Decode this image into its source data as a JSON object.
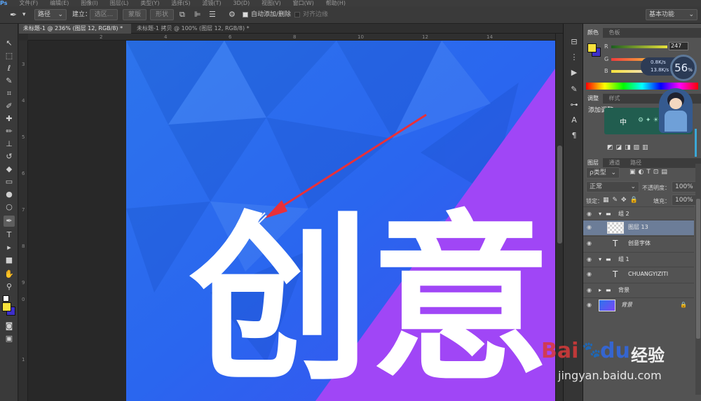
{
  "menubar": {
    "items": [
      "Ps",
      "文件(F)",
      "编辑(E)",
      "图像(I)",
      "图层(L)",
      "类型(Y)",
      "选择(S)",
      "滤镜(T)",
      "3D(D)",
      "视图(V)",
      "窗口(W)",
      "帮助(H)"
    ]
  },
  "options": {
    "tool_mode": "路径",
    "build_label": "建立：",
    "selection_btn": "选区...",
    "mask_btn": "蒙版",
    "shape_btn": "形状",
    "auto_add_delete": "自动添加/删除",
    "align_edges": "对齐边缘",
    "workspace": "基本功能"
  },
  "tabs": [
    {
      "label": "未标题-1 @ 236% (图层 12, RGB/8) *",
      "active": true
    },
    {
      "label": "未标题-1 拷贝 @ 100% (图层 12, RGB/8) *",
      "active": false
    }
  ],
  "ruler": {
    "top": [
      "2",
      "4",
      "6",
      "8",
      "10",
      "12",
      "14"
    ],
    "left": [
      "3",
      "4",
      "5",
      "6",
      "7",
      "8",
      "9",
      "0",
      "1"
    ]
  },
  "canvas": {
    "text": "创意",
    "colors": {
      "blue": "#2a6ff0",
      "purple": "#a046f6",
      "text": "#ffffff",
      "arrow": "#e8303a"
    }
  },
  "color_panel": {
    "tabs": [
      "颜色",
      "色板"
    ],
    "r_label": "R",
    "g_label": "G",
    "b_label": "B",
    "r_value": "247",
    "foreground": "#f7e13c",
    "background": "#3d2fc9"
  },
  "speed_widget": {
    "percent": "56",
    "percent_sign": "%",
    "up": "0.8K/s",
    "down": "13.8K/s"
  },
  "adjust_panel": {
    "tabs": [
      "调整",
      "样式"
    ],
    "title": "添加调整",
    "button_char": "中"
  },
  "layers_panel": {
    "tabs": [
      "图层",
      "通道",
      "路径"
    ],
    "kind": "ρ类型",
    "blend": "正常",
    "opacity_label": "不透明度：",
    "opacity": "100%",
    "lock_label": "锁定：",
    "fill_label": "填充：",
    "fill": "100%",
    "layers": [
      {
        "name": "组 2",
        "kind": "group",
        "indent": 0
      },
      {
        "name": "图层 13",
        "kind": "layer",
        "indent": 1,
        "selected": true
      },
      {
        "name": "创意字体",
        "kind": "text",
        "indent": 1
      },
      {
        "name": "组 1",
        "kind": "group",
        "indent": 0
      },
      {
        "name": "CHUANGYIZITI",
        "kind": "text",
        "indent": 1
      },
      {
        "name": "背景",
        "kind": "group",
        "indent": 0
      },
      {
        "name": "背景",
        "kind": "bg",
        "indent": 0
      }
    ]
  },
  "watermark": {
    "brand": "Bai",
    "brand2": "du",
    "brand_cn": "经验",
    "url": "jingyan.baidu.com"
  }
}
